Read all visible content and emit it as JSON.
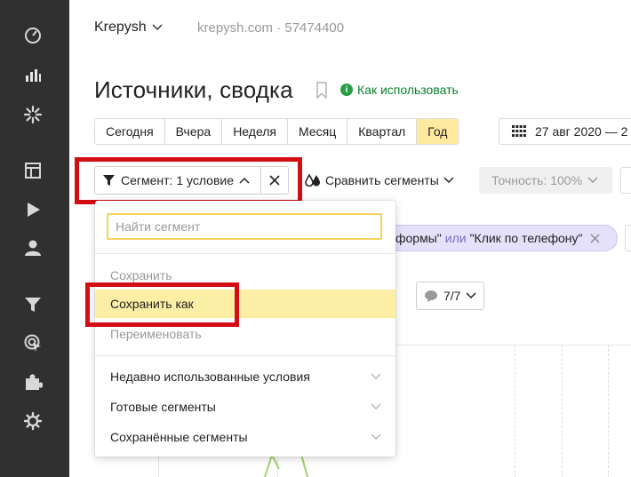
{
  "header": {
    "counter_name": "Krepysh",
    "counter_site": "krepysh.com · 57474400"
  },
  "page": {
    "title": "Источники, сводка",
    "howto_label": "Как использовать",
    "howto_icon": "i"
  },
  "periods": [
    "Сегодня",
    "Вчера",
    "Неделя",
    "Месяц",
    "Квартал",
    "Год"
  ],
  "active_period": "Год",
  "date_range": "27 авг 2020 — 2",
  "toolbar": {
    "segment_label": "Сегмент: 1 условие",
    "compare_label": "Сравнить сегменты",
    "accuracy_label": "Точность: 100%"
  },
  "condition_chip": {
    "left_text": "формы\"",
    "or_text": "или",
    "right_text": "\"Клик по телефону\""
  },
  "comments_btn": {
    "label": "7/7"
  },
  "dropdown": {
    "search_placeholder": "Найти сегмент",
    "actions": [
      {
        "label": "Сохранить",
        "state": "disabled"
      },
      {
        "label": "Сохранить как",
        "state": "highlighted"
      },
      {
        "label": "Переименовать",
        "state": "disabled"
      }
    ],
    "groups": [
      "Недавно использованные условия",
      "Готовые сегменты",
      "Сохранённые сегменты"
    ]
  },
  "colors": {
    "rail": "#303030",
    "accent_yellow": "#ffeba0",
    "highlight_frame": "#d20d14",
    "condition_chip": "#e5e1fb",
    "howto_green": "#0a7f2e"
  },
  "rail_icons": [
    "dashboard-icon",
    "reports-icon",
    "burst-icon",
    "layout-icon",
    "play-icon",
    "user-icon",
    "filter-icon",
    "target-icon",
    "puzzle-icon",
    "gear-icon"
  ]
}
